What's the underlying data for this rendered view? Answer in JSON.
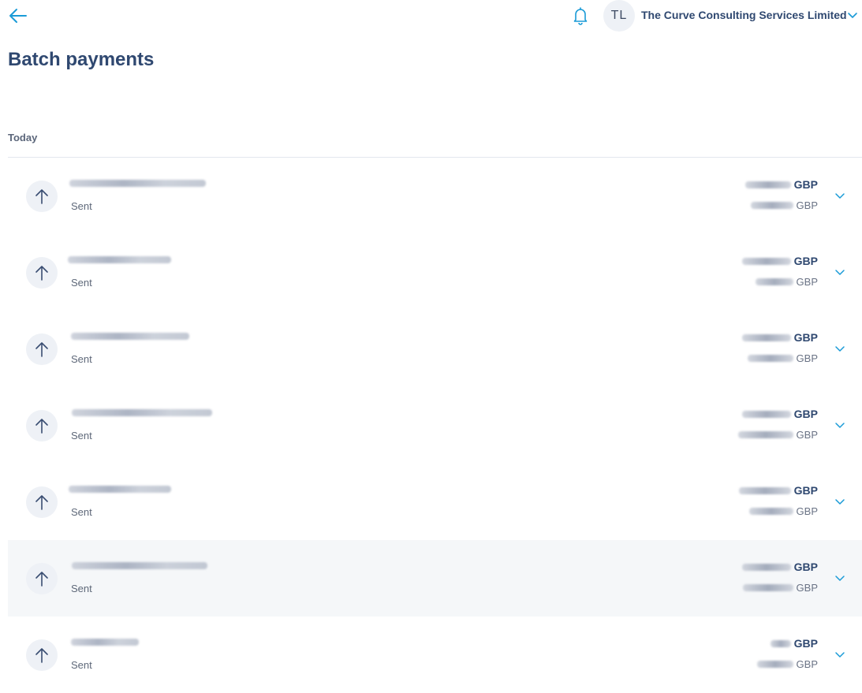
{
  "header": {
    "avatar_initials": "TL",
    "company_name": "The Curve Consulting Services Limited"
  },
  "page": {
    "title": "Batch payments",
    "section_label": "Today"
  },
  "colors": {
    "accent": "#1a9bd7",
    "title": "#2f4870",
    "highlight_row": "#f5f7f9"
  },
  "payments": [
    {
      "status": "Sent",
      "currency": "GBP",
      "sub_currency": "GBP"
    },
    {
      "status": "Sent",
      "currency": "GBP",
      "sub_currency": "GBP"
    },
    {
      "status": "Sent",
      "currency": "GBP",
      "sub_currency": "GBP"
    },
    {
      "status": "Sent",
      "currency": "GBP",
      "sub_currency": "GBP"
    },
    {
      "status": "Sent",
      "currency": "GBP",
      "sub_currency": "GBP"
    },
    {
      "status": "Sent",
      "currency": "GBP",
      "sub_currency": "GBP"
    },
    {
      "status": "Sent",
      "currency": "GBP",
      "sub_currency": "GBP"
    }
  ]
}
